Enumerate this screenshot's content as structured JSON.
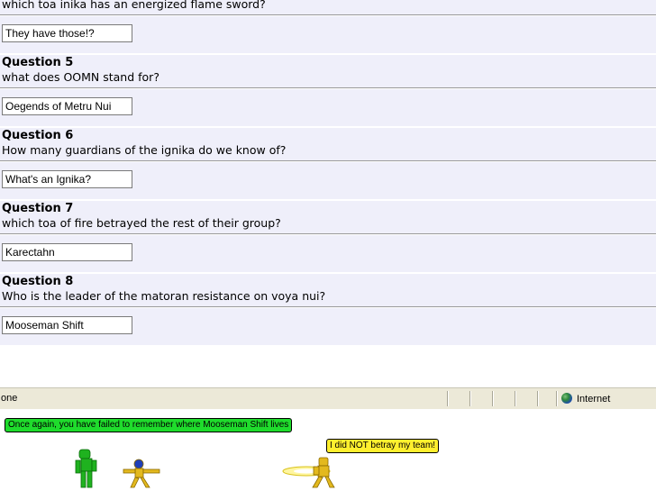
{
  "partial_question_text": "which toa inika has an energized flame sword?",
  "partial_answer": "They have those!?",
  "questions": [
    {
      "title": "Question 5",
      "text": "what does OOMN stand for?",
      "answer": "Oegends of Metru Nui"
    },
    {
      "title": "Question 6",
      "text": "How many guardians of the ignika do we know of?",
      "answer": "What's an Ignika?"
    },
    {
      "title": "Question 7",
      "text": "which toa of fire betrayed the rest of their group?",
      "answer": "Karectahn"
    },
    {
      "title": "Question 8",
      "text": "Who is the leader of the matoran resistance on voya nui?",
      "answer": "Mooseman Shift"
    }
  ],
  "statusbar": {
    "status_text": "one",
    "zone_label": "Internet",
    "zone_icon": "globe-icon"
  },
  "scene": {
    "speech_left": "Once again, you have failed to remember where Mooseman Shift lives",
    "speech_right": "I did NOT betray my team!",
    "colors": {
      "green_bubble": "#1fdc2c",
      "yellow_bubble": "#ffef2e",
      "green_figure": "#1fb21f",
      "gold_figure": "#e3b91e"
    }
  }
}
